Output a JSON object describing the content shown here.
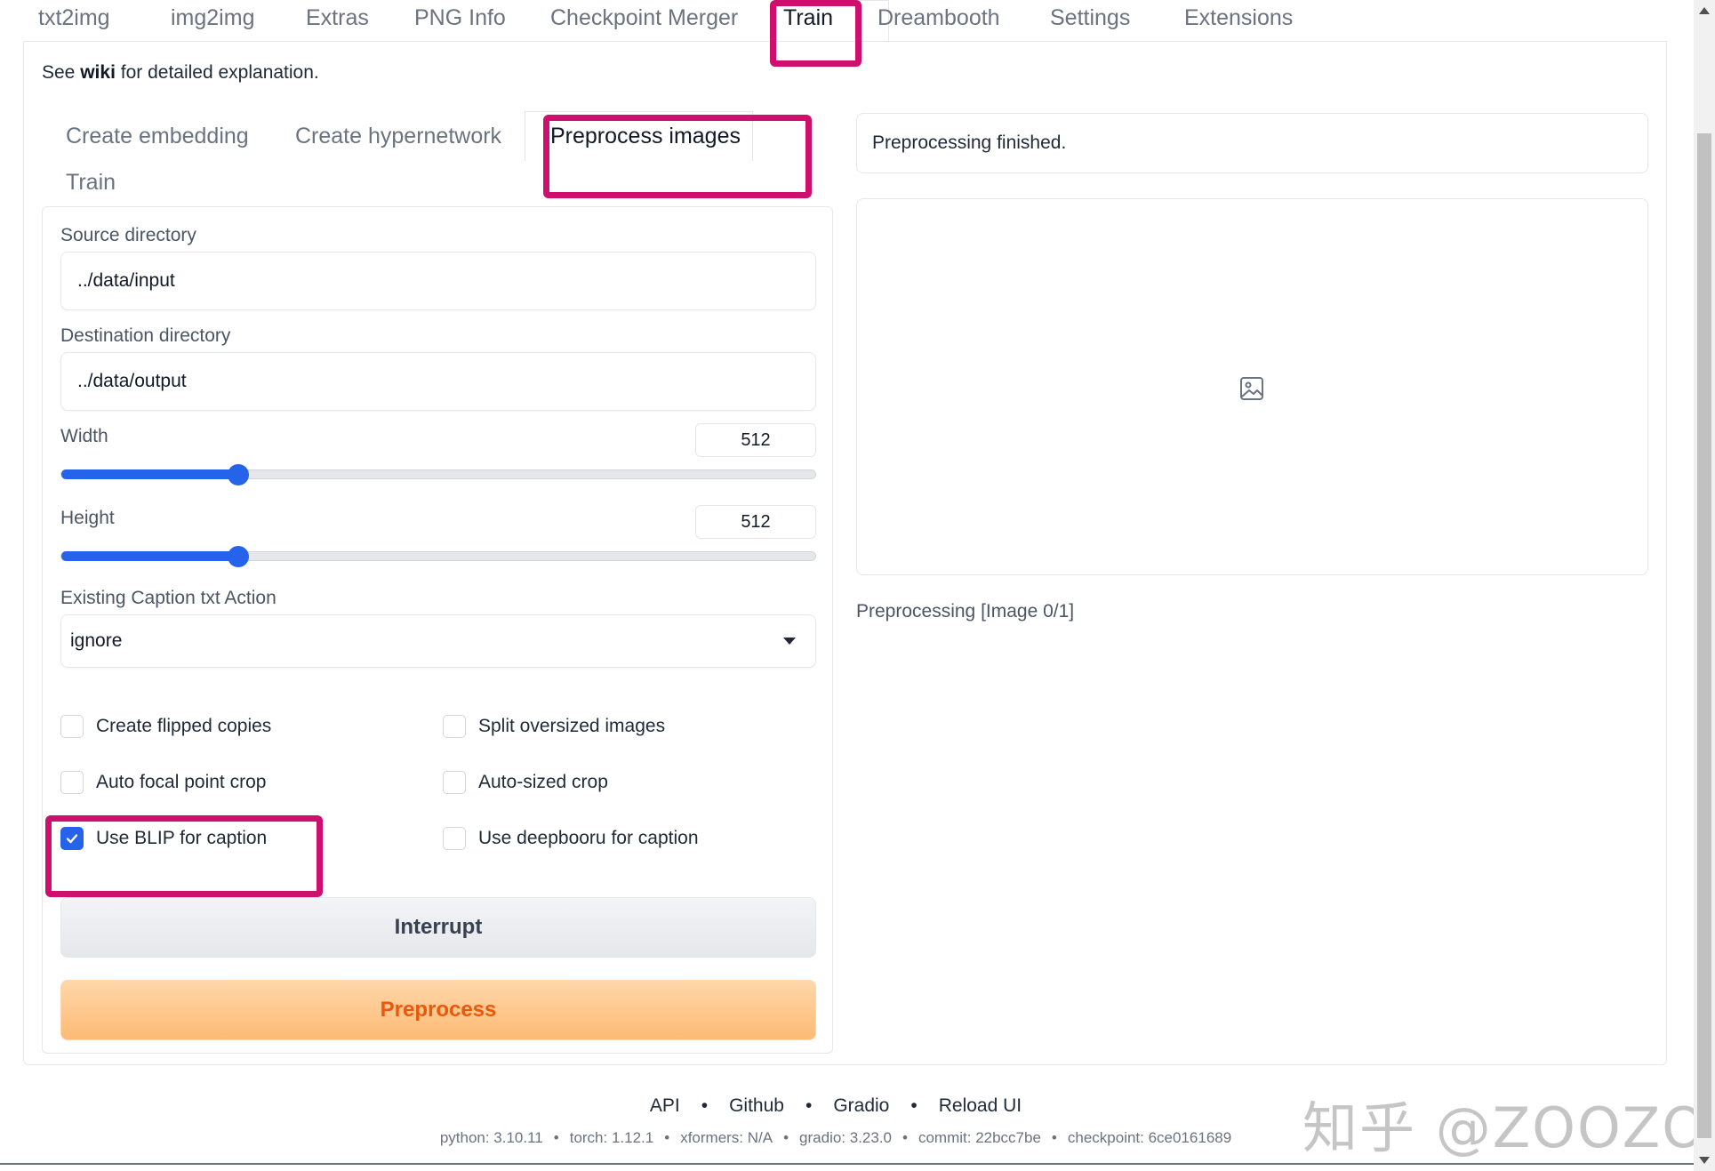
{
  "top_tabs": [
    {
      "label": "txt2img"
    },
    {
      "label": "img2img"
    },
    {
      "label": "Extras"
    },
    {
      "label": "PNG Info"
    },
    {
      "label": "Checkpoint Merger"
    },
    {
      "label": "Train"
    },
    {
      "label": "Dreambooth"
    },
    {
      "label": "Settings"
    },
    {
      "label": "Extensions"
    }
  ],
  "active_top_tab": "Train",
  "wiki_line": {
    "prefix": "See",
    "link": "wiki",
    "suffix": "for detailed explanation."
  },
  "sub_tabs": [
    {
      "label": "Create embedding"
    },
    {
      "label": "Create hypernetwork"
    },
    {
      "label": "Preprocess images"
    },
    {
      "label": "Train"
    }
  ],
  "active_sub_tab": "Preprocess images",
  "form": {
    "source_dir": {
      "label": "Source directory",
      "value": "../data/input"
    },
    "dest_dir": {
      "label": "Destination directory",
      "value": "../data/output"
    },
    "width": {
      "label": "Width",
      "value": "512",
      "fraction": 0.235
    },
    "height": {
      "label": "Height",
      "value": "512",
      "fraction": 0.235
    },
    "caption_action": {
      "label": "Existing Caption txt Action",
      "value": "ignore"
    },
    "checkboxes": [
      {
        "label": "Create flipped copies",
        "checked": false
      },
      {
        "label": "Split oversized images",
        "checked": false
      },
      {
        "label": "Auto focal point crop",
        "checked": false
      },
      {
        "label": "Auto-sized crop",
        "checked": false
      },
      {
        "label": "Use BLIP for caption",
        "checked": true
      },
      {
        "label": "Use deepbooru for caption",
        "checked": false
      }
    ],
    "interrupt_label": "Interrupt",
    "preprocess_label": "Preprocess"
  },
  "output": {
    "status": "Preprocessing finished.",
    "progress": "Preprocessing [Image 0/1]",
    "gallery_icon": "image-icon"
  },
  "footer": {
    "links": [
      "API",
      "Github",
      "Gradio",
      "Reload UI"
    ],
    "versions": [
      "python: 3.10.11",
      "torch: 1.12.1",
      "xformers: N/A",
      "gradio: 3.23.0",
      "commit: 22bcc7be",
      "checkpoint: 6ce0161689"
    ]
  },
  "watermark": "知乎 @ZOOZOO",
  "colors": {
    "accent_blue": "#2563eb",
    "highlight_magenta": "#cf0f6e",
    "preprocess_orange": "#ea580c"
  }
}
